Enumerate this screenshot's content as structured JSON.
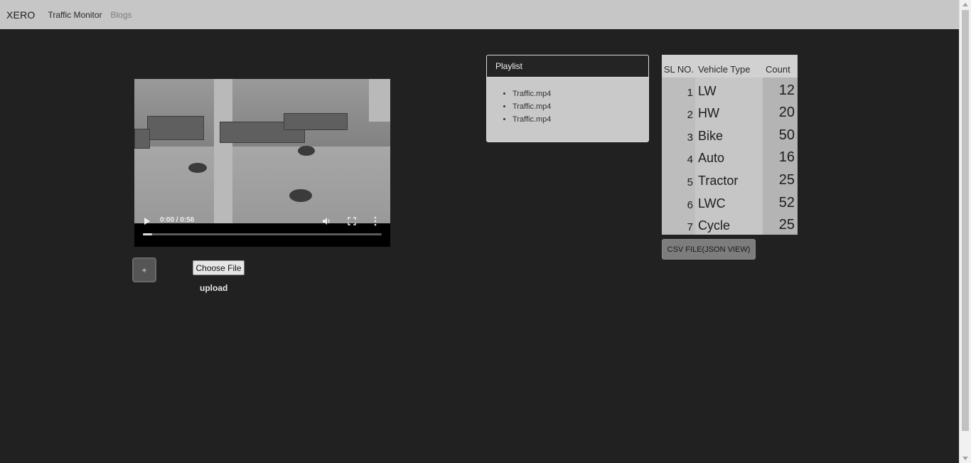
{
  "navbar": {
    "brand": "XERO",
    "links": [
      "Traffic Monitor",
      "Blogs"
    ]
  },
  "video": {
    "time": "0:00 / 0:56",
    "progress_fraction": 0.04
  },
  "controls": {
    "add_label": "+",
    "choose_file_label": "Choose File",
    "upload_label": "upload"
  },
  "playlist": {
    "title": "Playlist",
    "items": [
      "Traffic.mp4",
      "Traffic.mp4",
      "Traffic.mp4"
    ]
  },
  "table": {
    "headers": [
      "SL NO.",
      "Vehicle Type",
      "Count"
    ],
    "rows": [
      {
        "sl": "1",
        "type": "LW",
        "count": "12"
      },
      {
        "sl": "2",
        "type": "HW",
        "count": "20"
      },
      {
        "sl": "3",
        "type": "Bike",
        "count": "50"
      },
      {
        "sl": "4",
        "type": "Auto",
        "count": "16"
      },
      {
        "sl": "5",
        "type": "Tractor",
        "count": "25"
      },
      {
        "sl": "6",
        "type": "LWC",
        "count": "52"
      },
      {
        "sl": "7",
        "type": "Cycle",
        "count": "25"
      }
    ]
  },
  "csv_button": "CSV FILE(JSON VIEW)",
  "colors": {
    "page_background": "#212121",
    "navbar_background": "#c6c6c6"
  }
}
